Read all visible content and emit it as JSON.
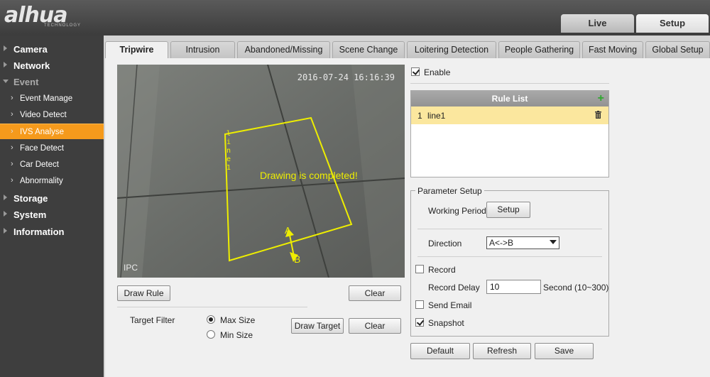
{
  "header": {
    "logo": "alhua",
    "logo_sub": "TECHNOLOGY",
    "nav": [
      {
        "label": "Live"
      },
      {
        "label": "Setup"
      }
    ]
  },
  "sidebar": {
    "items": [
      {
        "label": "Camera"
      },
      {
        "label": "Network"
      },
      {
        "label": "Event"
      },
      {
        "label": "Event Manage"
      },
      {
        "label": "Video Detect"
      },
      {
        "label": "IVS Analyse"
      },
      {
        "label": "Face Detect"
      },
      {
        "label": "Car Detect"
      },
      {
        "label": "Abnormality"
      },
      {
        "label": "Storage"
      },
      {
        "label": "System"
      },
      {
        "label": "Information"
      }
    ]
  },
  "tabs": [
    {
      "label": "Tripwire"
    },
    {
      "label": "Intrusion"
    },
    {
      "label": "Abandoned/Missing"
    },
    {
      "label": "Scene Change"
    },
    {
      "label": "Loitering Detection"
    },
    {
      "label": "People Gathering"
    },
    {
      "label": "Fast Moving"
    },
    {
      "label": "Global Setup"
    }
  ],
  "video": {
    "timestamp": "2016-07-24 16:16:39",
    "channel": "IPC",
    "message": "Drawing is completed!",
    "line_label": "line1",
    "point_a": "A",
    "point_b": "B"
  },
  "left_controls": {
    "draw_rule": "Draw Rule",
    "clear1": "Clear",
    "target_filter_label": "Target Filter",
    "max_size": "Max Size",
    "min_size": "Min Size",
    "draw_target": "Draw Target",
    "clear2": "Clear"
  },
  "enable_label": "Enable",
  "rule_list": {
    "title": "Rule List",
    "rows": [
      {
        "index": "1",
        "name": "line1"
      }
    ]
  },
  "params": {
    "legend": "Parameter Setup",
    "working_period_label": "Working Period",
    "setup_button": "Setup",
    "direction_label": "Direction",
    "direction_value": "A<->B",
    "record_label": "Record",
    "record_delay_label": "Record Delay",
    "record_delay_value": "10",
    "record_delay_unit": "Second (10~300)",
    "send_email_label": "Send Email",
    "snapshot_label": "Snapshot"
  },
  "footer_buttons": {
    "default": "Default",
    "refresh": "Refresh",
    "save": "Save"
  },
  "colors": {
    "accent": "#f59a1c",
    "overlay": "#eeee00",
    "rule_highlight": "#fbe79e"
  }
}
